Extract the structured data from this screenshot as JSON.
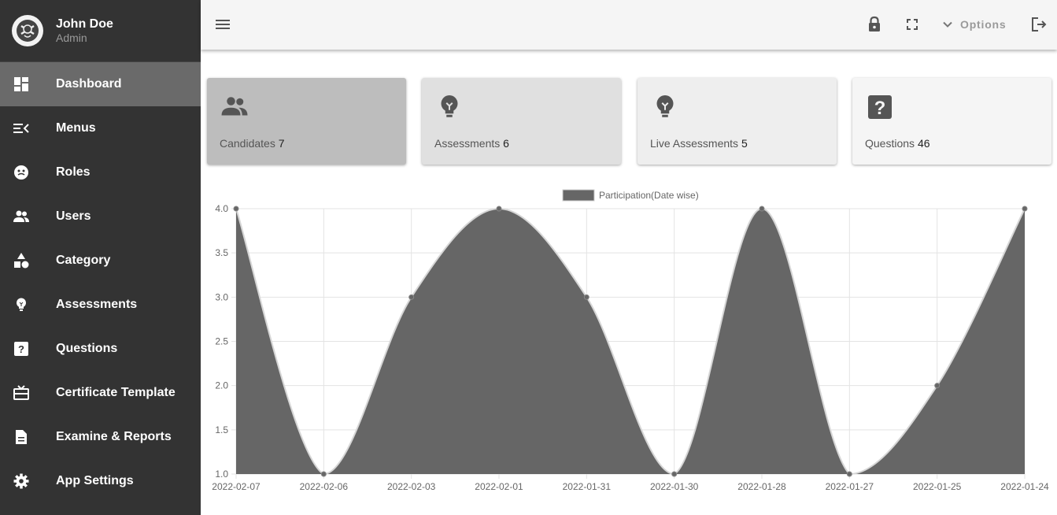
{
  "user": {
    "name": "John Doe",
    "role": "Admin"
  },
  "sidebar": {
    "items": [
      {
        "label": "Dashboard",
        "icon": "dashboard-icon",
        "active": true
      },
      {
        "label": "Menus",
        "icon": "menu-open-icon"
      },
      {
        "label": "Roles",
        "icon": "roles-icon"
      },
      {
        "label": "Users",
        "icon": "users-icon"
      },
      {
        "label": "Category",
        "icon": "category-icon"
      },
      {
        "label": "Assessments",
        "icon": "lightbulb-icon"
      },
      {
        "label": "Questions",
        "icon": "question-icon"
      },
      {
        "label": "Certificate Template",
        "icon": "certificate-icon"
      },
      {
        "label": "Examine & Reports",
        "icon": "report-icon"
      },
      {
        "label": "App Settings",
        "icon": "gear-icon"
      }
    ]
  },
  "topbar": {
    "options_label": "Options"
  },
  "cards": [
    {
      "label": "Candidates",
      "count": "7",
      "icon": "users-icon",
      "bg": "#bdbdbd"
    },
    {
      "label": "Assessments",
      "count": "6",
      "icon": "lightbulb-icon",
      "bg": "#e0e0e0"
    },
    {
      "label": "Live Assessments",
      "count": "5",
      "icon": "lightbulb-icon",
      "bg": "#eeeeee"
    },
    {
      "label": "Questions",
      "count": "46",
      "icon": "question-icon",
      "bg": "#f5f5f5"
    }
  ],
  "colors": {
    "sidebar": "#333333",
    "active_item": "#6a6a6a",
    "series_fill": "#666666"
  },
  "chart_data": {
    "type": "area",
    "x": [
      "2022-02-07",
      "2022-02-06",
      "2022-02-03",
      "2022-02-01",
      "2022-01-31",
      "2022-01-30",
      "2022-01-28",
      "2022-01-27",
      "2022-01-25",
      "2022-01-24"
    ],
    "series": [
      {
        "name": "Participation(Date wise)",
        "values": [
          4,
          1,
          3,
          4,
          3,
          1,
          4,
          1,
          2,
          4
        ]
      }
    ],
    "ylim": [
      1.0,
      4.0
    ],
    "yticks": [
      "4.0",
      "3.5",
      "3.0",
      "2.5",
      "2.0",
      "1.5",
      "1.0"
    ],
    "grid": true,
    "legend": "top-center"
  }
}
